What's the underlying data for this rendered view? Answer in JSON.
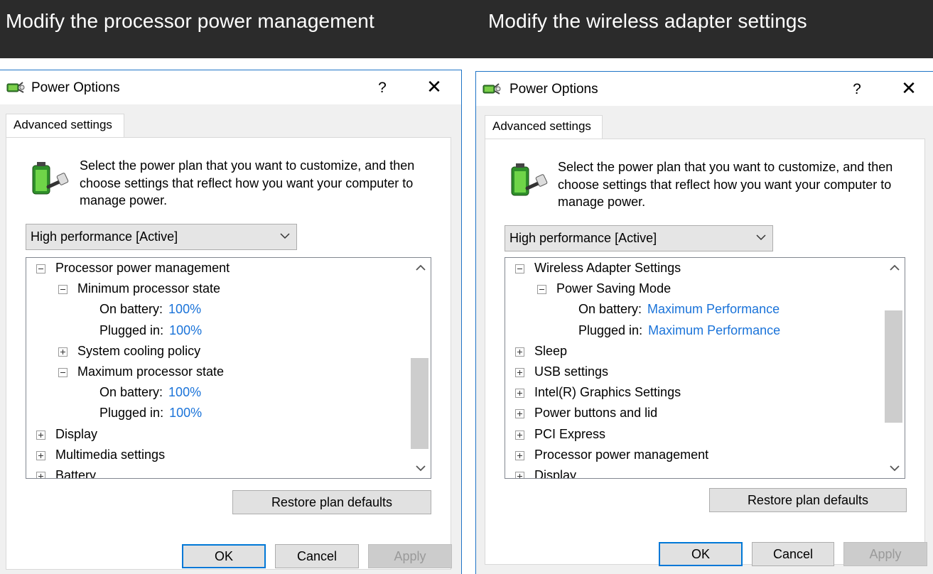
{
  "banner": {
    "left_title": "Modify the processor power management",
    "right_title": "Modify the wireless adapter settings"
  },
  "left_dialog": {
    "title": "Power Options",
    "help": "?",
    "close": "✕",
    "tab": "Advanced settings",
    "description": "Select the power plan that you want to customize, and then choose settings that reflect how you want your computer to manage power.",
    "plan_select": "High performance [Active]",
    "tree": [
      {
        "toggle": "minus",
        "label": "Processor power management",
        "value": ""
      },
      {
        "toggle": "minus",
        "label": "Minimum processor state",
        "value": ""
      },
      {
        "toggle": "",
        "label": "On battery:",
        "value": "100%"
      },
      {
        "toggle": "",
        "label": "Plugged in:",
        "value": "100%"
      },
      {
        "toggle": "plus",
        "label": "System cooling policy",
        "value": ""
      },
      {
        "toggle": "minus",
        "label": "Maximum processor state",
        "value": ""
      },
      {
        "toggle": "",
        "label": "On battery:",
        "value": "100%"
      },
      {
        "toggle": "",
        "label": "Plugged in:",
        "value": "100%"
      },
      {
        "toggle": "plus",
        "label": "Display",
        "value": ""
      },
      {
        "toggle": "plus",
        "label": "Multimedia settings",
        "value": ""
      },
      {
        "toggle": "plus",
        "label": "Battery",
        "value": ""
      }
    ],
    "restore_label": "Restore plan defaults",
    "ok_label": "OK",
    "cancel_label": "Cancel",
    "apply_label": "Apply"
  },
  "right_dialog": {
    "title": "Power Options",
    "help": "?",
    "close": "✕",
    "tab": "Advanced settings",
    "description": "Select the power plan that you want to customize, and then choose settings that reflect how you want your computer to manage power.",
    "plan_select": "High performance [Active]",
    "tree": [
      {
        "toggle": "minus",
        "label": "Wireless Adapter Settings",
        "value": ""
      },
      {
        "toggle": "minus",
        "label": "Power Saving Mode",
        "value": ""
      },
      {
        "toggle": "",
        "label": "On battery:",
        "value": "Maximum Performance"
      },
      {
        "toggle": "",
        "label": "Plugged in:",
        "value": "Maximum Performance"
      },
      {
        "toggle": "plus",
        "label": "Sleep",
        "value": ""
      },
      {
        "toggle": "plus",
        "label": "USB settings",
        "value": ""
      },
      {
        "toggle": "plus",
        "label": "Intel(R) Graphics Settings",
        "value": ""
      },
      {
        "toggle": "plus",
        "label": "Power buttons and lid",
        "value": ""
      },
      {
        "toggle": "plus",
        "label": "PCI Express",
        "value": ""
      },
      {
        "toggle": "plus",
        "label": "Processor power management",
        "value": ""
      },
      {
        "toggle": "plus",
        "label": "Display",
        "value": ""
      }
    ],
    "restore_label": "Restore plan defaults",
    "ok_label": "OK",
    "cancel_label": "Cancel",
    "apply_label": "Apply"
  },
  "colors": {
    "banner_bg": "#2b2b2b",
    "dialog_border": "#1f74c7",
    "value_link": "#1a73d9",
    "ok_focus": "#0078d7"
  },
  "icons": [
    "power-options-icon",
    "battery-plug-icon",
    "chevron-down-icon",
    "tree-expand-icon",
    "tree-collapse-icon",
    "scroll-up-icon",
    "scroll-down-icon"
  ]
}
